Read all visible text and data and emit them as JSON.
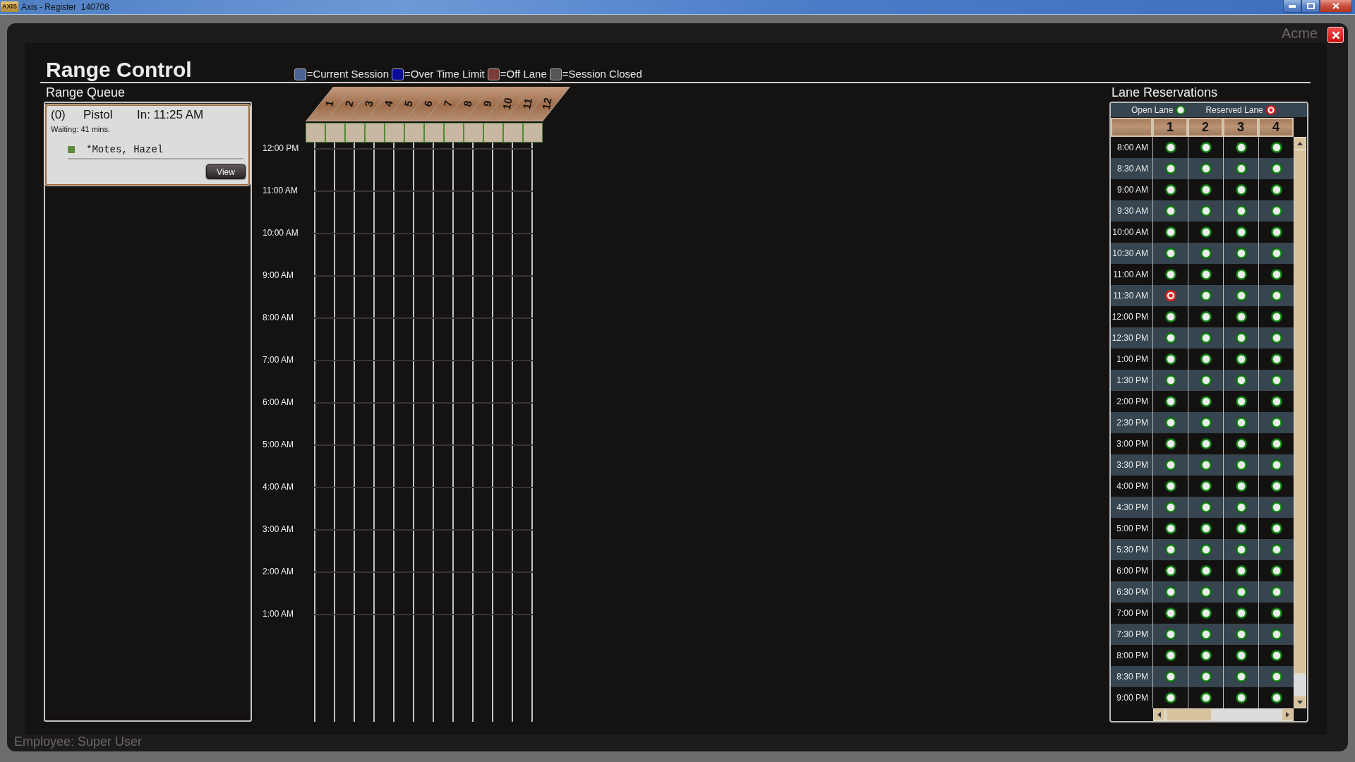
{
  "window": {
    "app_badge": "AXIS",
    "title": "Axis - Register  140708"
  },
  "background": {
    "company": "Acme",
    "footer": "Employee: Super User"
  },
  "dialog": {
    "title": "Range Control",
    "legend": [
      {
        "label": "=Current Session",
        "color": "#4a6396"
      },
      {
        "label": "=Over Time Limit",
        "color": "#0c0c9a"
      },
      {
        "label": "=Off Lane",
        "color": "#7c3c3c"
      },
      {
        "label": "=Session Closed",
        "color": "#565656"
      }
    ]
  },
  "range_queue": {
    "title": "Range Queue",
    "entries": [
      {
        "number": "(0)",
        "type": "Pistol",
        "check_in": "In: 11:25 AM",
        "waiting": "Waiting: 41 mins.",
        "shooters": [
          {
            "name": "*Motes, Hazel",
            "color": "#5e8c3e"
          }
        ],
        "button": "View"
      }
    ]
  },
  "range_timeline": {
    "lanes": [
      "1",
      "2",
      "3",
      "4",
      "5",
      "6",
      "7",
      "8",
      "9",
      "10",
      "11",
      "12"
    ],
    "hours": [
      "12:00 PM",
      "11:00 AM",
      "10:00 AM",
      "9:00 AM",
      "8:00 AM",
      "7:00 AM",
      "6:00 AM",
      "5:00 AM",
      "4:00 AM",
      "3:00 AM",
      "2:00 AM",
      "1:00 AM"
    ]
  },
  "lane_reservations": {
    "title": "Lane Reservations",
    "legend": {
      "open": "Open Lane",
      "reserved": "Reserved Lane"
    },
    "lanes": [
      "1",
      "2",
      "3",
      "4"
    ],
    "rows": [
      {
        "time": "8:00 AM",
        "reserved": [
          false,
          false,
          false,
          false
        ]
      },
      {
        "time": "8:30 AM",
        "reserved": [
          false,
          false,
          false,
          false
        ]
      },
      {
        "time": "9:00 AM",
        "reserved": [
          false,
          false,
          false,
          false
        ]
      },
      {
        "time": "9:30 AM",
        "reserved": [
          false,
          false,
          false,
          false
        ]
      },
      {
        "time": "10:00 AM",
        "reserved": [
          false,
          false,
          false,
          false
        ]
      },
      {
        "time": "10:30 AM",
        "reserved": [
          false,
          false,
          false,
          false
        ]
      },
      {
        "time": "11:00 AM",
        "reserved": [
          false,
          false,
          false,
          false
        ]
      },
      {
        "time": "11:30 AM",
        "reserved": [
          true,
          false,
          false,
          false
        ]
      },
      {
        "time": "12:00 PM",
        "reserved": [
          false,
          false,
          false,
          false
        ]
      },
      {
        "time": "12:30 PM",
        "reserved": [
          false,
          false,
          false,
          false
        ]
      },
      {
        "time": "1:00 PM",
        "reserved": [
          false,
          false,
          false,
          false
        ]
      },
      {
        "time": "1:30 PM",
        "reserved": [
          false,
          false,
          false,
          false
        ]
      },
      {
        "time": "2:00 PM",
        "reserved": [
          false,
          false,
          false,
          false
        ]
      },
      {
        "time": "2:30 PM",
        "reserved": [
          false,
          false,
          false,
          false
        ]
      },
      {
        "time": "3:00 PM",
        "reserved": [
          false,
          false,
          false,
          false
        ]
      },
      {
        "time": "3:30 PM",
        "reserved": [
          false,
          false,
          false,
          false
        ]
      },
      {
        "time": "4:00 PM",
        "reserved": [
          false,
          false,
          false,
          false
        ]
      },
      {
        "time": "4:30 PM",
        "reserved": [
          false,
          false,
          false,
          false
        ]
      },
      {
        "time": "5:00 PM",
        "reserved": [
          false,
          false,
          false,
          false
        ]
      },
      {
        "time": "5:30 PM",
        "reserved": [
          false,
          false,
          false,
          false
        ]
      },
      {
        "time": "6:00 PM",
        "reserved": [
          false,
          false,
          false,
          false
        ]
      },
      {
        "time": "6:30 PM",
        "reserved": [
          false,
          false,
          false,
          false
        ]
      },
      {
        "time": "7:00 PM",
        "reserved": [
          false,
          false,
          false,
          false
        ]
      },
      {
        "time": "7:30 PM",
        "reserved": [
          false,
          false,
          false,
          false
        ]
      },
      {
        "time": "8:00 PM",
        "reserved": [
          false,
          false,
          false,
          false
        ]
      },
      {
        "time": "8:30 PM",
        "reserved": [
          false,
          false,
          false,
          false
        ]
      },
      {
        "time": "9:00 PM",
        "reserved": [
          false,
          false,
          false,
          false
        ]
      }
    ]
  }
}
